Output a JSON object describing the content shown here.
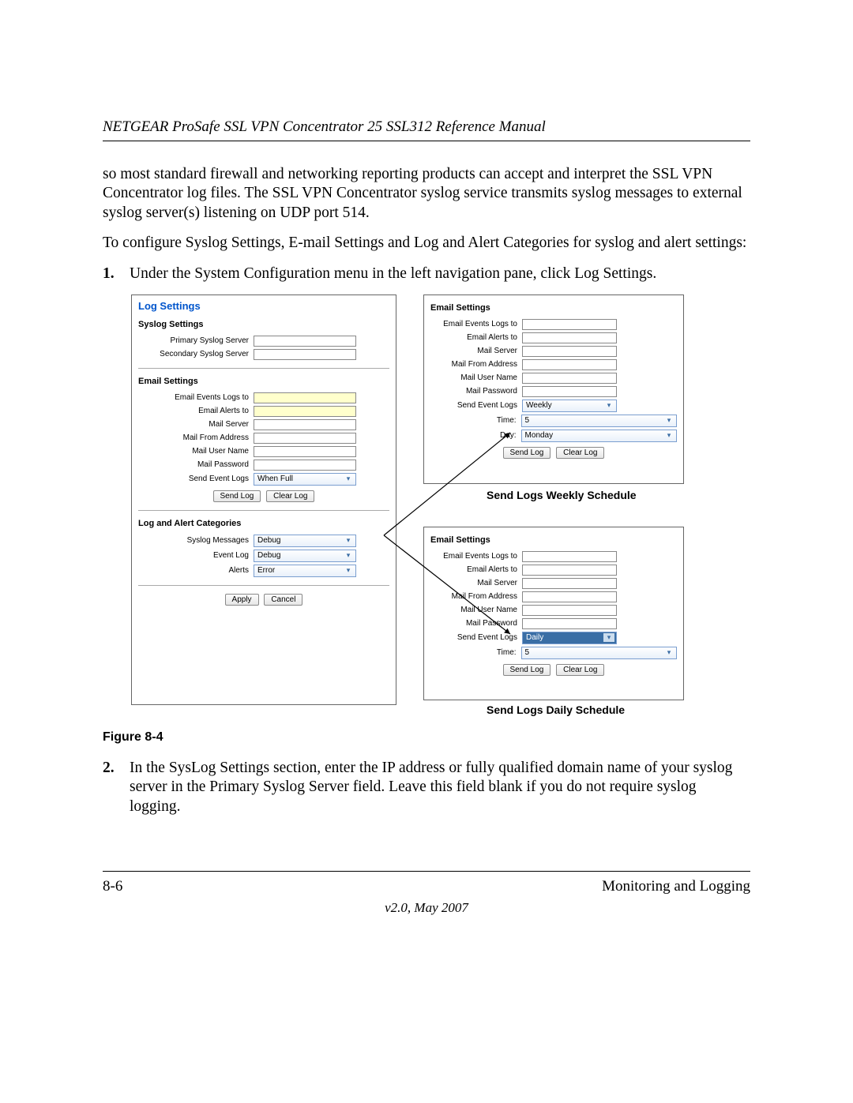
{
  "header": {
    "title": "NETGEAR ProSafe SSL VPN Concentrator 25 SSL312 Reference Manual"
  },
  "paragraphs": {
    "p1": "so most standard firewall and networking reporting products can accept and interpret the SSL VPN Concentrator log files. The SSL VPN Concentrator syslog service transmits syslog messages to external syslog server(s) listening on UDP port 514.",
    "p2": "To configure Syslog Settings, E-mail Settings and Log and Alert Categories for syslog and alert settings:"
  },
  "steps": {
    "s1_num": "1.",
    "s1_text": "Under the System Configuration menu in the left navigation pane, click Log Settings.",
    "s2_num": "2.",
    "s2_text": "In the SysLog Settings section, enter the IP address or fully qualified domain name of your syslog server in the Primary Syslog Server field. Leave this field blank if you do not require syslog logging."
  },
  "main_panel": {
    "title": "Log Settings",
    "syslog_section": "Syslog Settings",
    "primary_label": "Primary Syslog Server",
    "secondary_label": "Secondary Syslog Server",
    "email_section": "Email Settings",
    "email_events_label": "Email Events Logs to",
    "email_alerts_label": "Email Alerts to",
    "mail_server_label": "Mail Server",
    "mail_from_label": "Mail From Address",
    "mail_user_label": "Mail User Name",
    "mail_pass_label": "Mail Password",
    "send_event_label": "Send Event Logs",
    "send_event_value": "When Full",
    "send_log_btn": "Send Log",
    "clear_log_btn": "Clear Log",
    "cat_section": "Log and Alert Categories",
    "syslog_msgs_label": "Syslog Messages",
    "syslog_msgs_value": "Debug",
    "event_log_label": "Event Log",
    "event_log_value": "Debug",
    "alerts_label": "Alerts",
    "alerts_value": "Error",
    "apply_btn": "Apply",
    "cancel_btn": "Cancel"
  },
  "weekly_panel": {
    "title": "Email Settings",
    "email_events_label": "Email Events Logs to",
    "email_alerts_label": "Email Alerts to",
    "mail_server_label": "Mail Server",
    "mail_from_label": "Mail From Address",
    "mail_user_label": "Mail User Name",
    "mail_pass_label": "Mail Password",
    "send_event_label": "Send Event Logs",
    "send_event_value": "Weekly",
    "time_label": "Time:",
    "time_value": "5",
    "day_label": "Day:",
    "day_value": "Monday",
    "send_log_btn": "Send Log",
    "clear_log_btn": "Clear Log",
    "caption": "Send Logs Weekly Schedule"
  },
  "daily_panel": {
    "title": "Email Settings",
    "email_events_label": "Email Events Logs to",
    "email_alerts_label": "Email Alerts to",
    "mail_server_label": "Mail Server",
    "mail_from_label": "Mail From Address",
    "mail_user_label": "Mail User Name",
    "mail_pass_label": "Mail Password",
    "send_event_label": "Send Event Logs",
    "send_event_value": "Daily",
    "time_label": "Time:",
    "time_value": "5",
    "send_log_btn": "Send Log",
    "clear_log_btn": "Clear Log",
    "caption": "Send Logs Daily Schedule"
  },
  "figure_caption": "Figure 8-4",
  "footer": {
    "page_num": "8-6",
    "section": "Monitoring and Logging",
    "version": "v2.0, May 2007"
  }
}
